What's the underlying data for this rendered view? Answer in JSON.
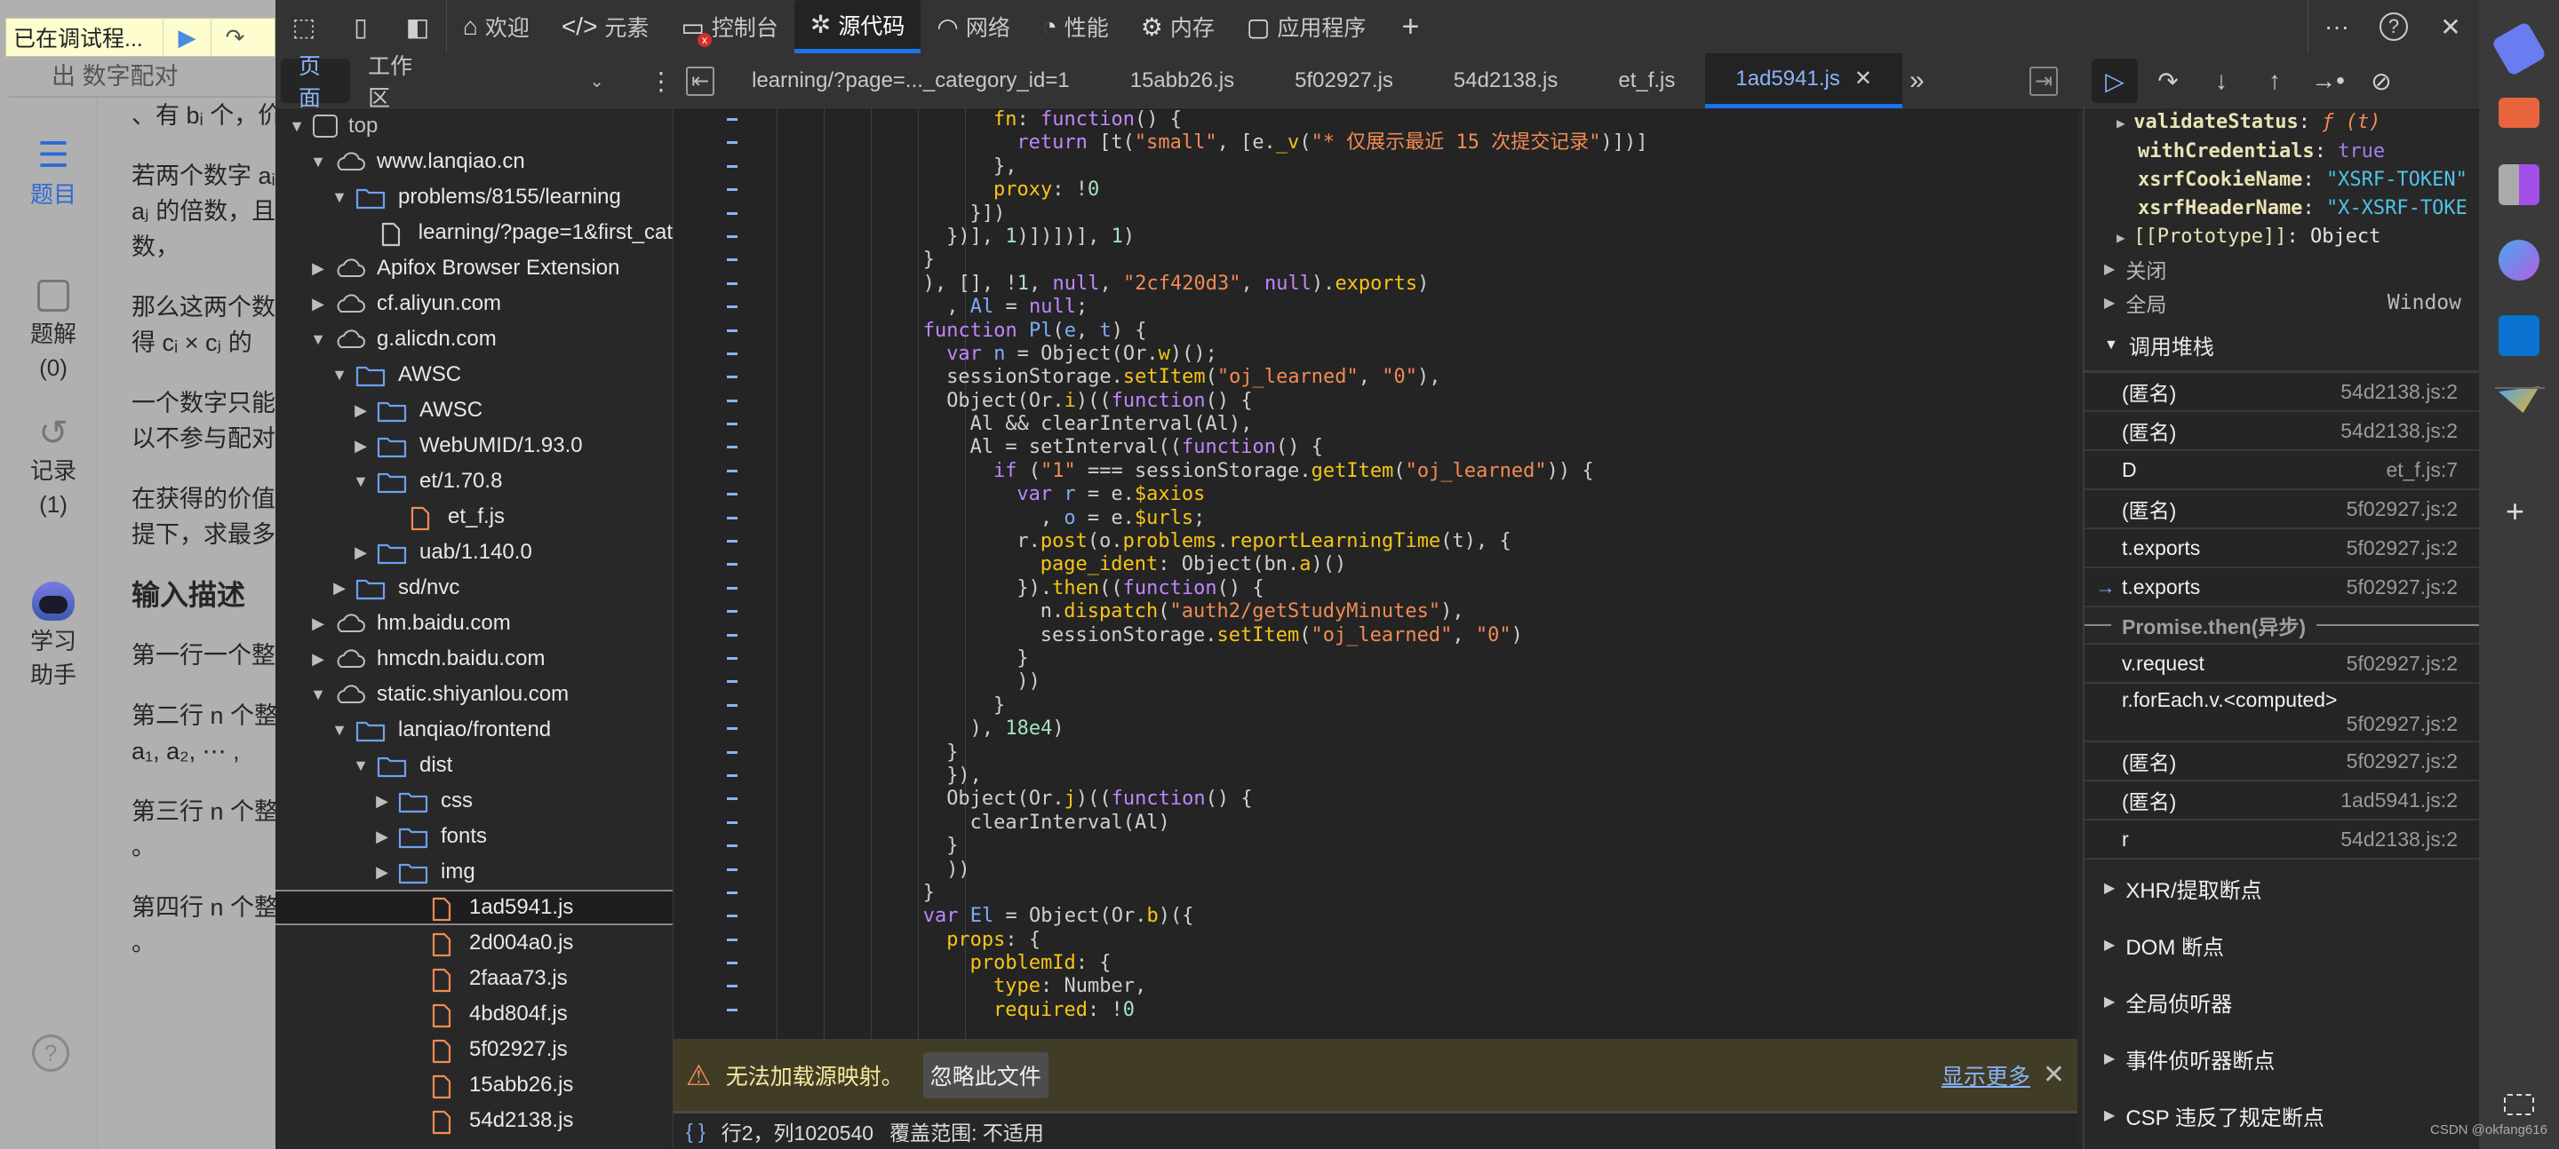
{
  "page": {
    "debug_banner": {
      "text": "已在调试程...",
      "resume_icon": "resume-icon",
      "step_over_icon": "step-over-icon"
    },
    "header_text": "出 数字配对",
    "leftbar": [
      {
        "label": "题目",
        "icon": "problem-list-icon",
        "active": true
      },
      {
        "label": "题解",
        "count": "(0)",
        "icon": "solution-book-icon"
      },
      {
        "label": "记录",
        "count": "(1)",
        "icon": "history-icon"
      },
      {
        "label": "学习",
        "label2": "助手",
        "icon": "assistant-robot-icon"
      }
    ],
    "content": {
      "line0": "、有 bᵢ 个，价",
      "para1": [
        "若两个数字 aᵢ",
        "aⱼ 的倍数，且",
        "数，"
      ],
      "para2": [
        "那么这两个数",
        "得 cᵢ × cⱼ 的"
      ],
      "para3": [
        "一个数字只能",
        "以不参与配对"
      ],
      "para4": [
        "在获得的价值",
        "提下，求最多"
      ],
      "heading": "输入描述",
      "para5": [
        "第一行一个整"
      ],
      "para6": [
        "第二行 n 个整",
        "a₁, a₂, ⋯ ,"
      ],
      "para7": [
        "第三行 n 个整",
        "。"
      ],
      "para8": [
        "第四行 n 个整",
        "。"
      ]
    }
  },
  "toolbar": {
    "tabs": [
      {
        "label": "欢迎",
        "icon": "home-icon"
      },
      {
        "label": "元素",
        "icon": "code-tag-icon"
      },
      {
        "label": "控制台",
        "icon": "console-icon",
        "error_badge": "x"
      },
      {
        "label": "源代码",
        "icon": "bug-icon",
        "active": true
      },
      {
        "label": "网络",
        "icon": "wifi-icon"
      },
      {
        "label": "性能",
        "icon": "gauge-icon"
      },
      {
        "label": "内存",
        "icon": "chip-icon"
      },
      {
        "label": "应用程序",
        "icon": "app-window-icon"
      }
    ],
    "add_tab": "+",
    "more": "···",
    "help": "?",
    "close": "✕"
  },
  "navigator": {
    "tabs": [
      {
        "label": "页面",
        "active": true
      },
      {
        "label": "工作区"
      }
    ],
    "tree": [
      {
        "label": "top",
        "type": "frame",
        "depth": 0,
        "expanded": true
      },
      {
        "label": "www.lanqiao.cn",
        "type": "cloud",
        "depth": 1,
        "expanded": true
      },
      {
        "label": "problems/8155/learning",
        "type": "folder",
        "depth": 2,
        "expanded": true
      },
      {
        "label": "learning/?page=1&first_cat",
        "type": "doc",
        "depth": 3
      },
      {
        "label": "Apifox Browser Extension",
        "type": "cloud",
        "depth": 1,
        "expanded": false
      },
      {
        "label": "cf.aliyun.com",
        "type": "cloud",
        "depth": 1,
        "expanded": false
      },
      {
        "label": "g.alicdn.com",
        "type": "cloud",
        "depth": 1,
        "expanded": true
      },
      {
        "label": "AWSC",
        "type": "folder",
        "depth": 2,
        "expanded": true
      },
      {
        "label": "AWSC",
        "type": "folder",
        "depth": 3,
        "expanded": false
      },
      {
        "label": "WebUMID/1.93.0",
        "type": "folder",
        "depth": 3,
        "expanded": false
      },
      {
        "label": "et/1.70.8",
        "type": "folder",
        "depth": 3,
        "expanded": true
      },
      {
        "label": "et_f.js",
        "type": "js",
        "depth": 4
      },
      {
        "label": "uab/1.140.0",
        "type": "folder",
        "depth": 3,
        "expanded": false
      },
      {
        "label": "sd/nvc",
        "type": "folder",
        "depth": 2,
        "expanded": false
      },
      {
        "label": "hm.baidu.com",
        "type": "cloud",
        "depth": 1,
        "expanded": false
      },
      {
        "label": "hmcdn.baidu.com",
        "type": "cloud",
        "depth": 1,
        "expanded": false
      },
      {
        "label": "static.shiyanlou.com",
        "type": "cloud",
        "depth": 1,
        "expanded": true
      },
      {
        "label": "lanqiao/frontend",
        "type": "folder",
        "depth": 2,
        "expanded": true
      },
      {
        "label": "dist",
        "type": "folder",
        "depth": 3,
        "expanded": true
      },
      {
        "label": "css",
        "type": "folder",
        "depth": 4,
        "expanded": false
      },
      {
        "label": "fonts",
        "type": "folder",
        "depth": 4,
        "expanded": false
      },
      {
        "label": "img",
        "type": "folder",
        "depth": 4,
        "expanded": false
      },
      {
        "label": "1ad5941.js",
        "type": "js",
        "depth": 5,
        "selected": true
      },
      {
        "label": "2d004a0.js",
        "type": "js",
        "depth": 5
      },
      {
        "label": "2faaa73.js",
        "type": "js",
        "depth": 5
      },
      {
        "label": "4bd804f.js",
        "type": "js",
        "depth": 5
      },
      {
        "label": "5f02927.js",
        "type": "js",
        "depth": 5
      },
      {
        "label": "15abb26.js",
        "type": "js",
        "depth": 5
      },
      {
        "label": "54d2138.js",
        "type": "js",
        "depth": 5
      }
    ]
  },
  "editor": {
    "tabs": [
      {
        "label": "learning/?page=..._category_id=1"
      },
      {
        "label": "15abb26.js"
      },
      {
        "label": "5f02927.js"
      },
      {
        "label": "54d2138.js"
      },
      {
        "label": "et_f.js"
      },
      {
        "label": "1ad5941.js",
        "active": true,
        "closable": true
      }
    ],
    "overflow": "»",
    "lines": [
      {
        "indent": 10,
        "tokens": [
          [
            "p",
            "fn"
          ],
          [
            "t",
            ": "
          ],
          [
            "k",
            "function"
          ],
          [
            "t",
            "() {"
          ]
        ]
      },
      {
        "indent": 12,
        "tokens": [
          [
            "k",
            "return"
          ],
          [
            "t",
            " [t("
          ],
          [
            "s",
            "\"small\""
          ],
          [
            "t",
            ", [e."
          ],
          [
            "p",
            "_v"
          ],
          [
            "t",
            "("
          ],
          [
            "s",
            "\"* 仅展示最近 15 次提交记录\""
          ],
          [
            "t",
            ")])]"
          ]
        ]
      },
      {
        "indent": 10,
        "tokens": [
          [
            "t",
            "},"
          ]
        ]
      },
      {
        "indent": 10,
        "tokens": [
          [
            "p",
            "proxy"
          ],
          [
            "t",
            ": !"
          ],
          [
            "n",
            "0"
          ]
        ]
      },
      {
        "indent": 8,
        "tokens": [
          [
            "t",
            "}])"
          ]
        ]
      },
      {
        "indent": 6,
        "tokens": [
          [
            "t",
            "})], "
          ],
          [
            "n",
            "1"
          ],
          [
            "t",
            ")])])], "
          ],
          [
            "n",
            "1"
          ],
          [
            "t",
            ")"
          ]
        ]
      },
      {
        "indent": 4,
        "tokens": [
          [
            "t",
            "}"
          ]
        ]
      },
      {
        "indent": 4,
        "tokens": [
          [
            "t",
            "), [], !"
          ],
          [
            "n",
            "1"
          ],
          [
            "t",
            ", "
          ],
          [
            "k",
            "null"
          ],
          [
            "t",
            ", "
          ],
          [
            "s",
            "\"2cf420d3\""
          ],
          [
            "t",
            ", "
          ],
          [
            "k",
            "null"
          ],
          [
            "t",
            ")."
          ],
          [
            "p",
            "exports"
          ],
          [
            "t",
            ")"
          ]
        ]
      },
      {
        "indent": 4,
        "tokens": [
          [
            "t",
            "  , "
          ],
          [
            "v",
            "Al"
          ],
          [
            "t",
            " = "
          ],
          [
            "k",
            "null"
          ],
          [
            "t",
            ";"
          ]
        ]
      },
      {
        "indent": 4,
        "tokens": [
          [
            "k",
            "function"
          ],
          [
            "t",
            " "
          ],
          [
            "v",
            "Pl"
          ],
          [
            "t",
            "("
          ],
          [
            "v",
            "e"
          ],
          [
            "t",
            ", "
          ],
          [
            "v",
            "t"
          ],
          [
            "t",
            ") {"
          ]
        ]
      },
      {
        "indent": 6,
        "tokens": [
          [
            "k",
            "var"
          ],
          [
            "t",
            " "
          ],
          [
            "v",
            "n"
          ],
          [
            "t",
            " = Object(Or."
          ],
          [
            "p",
            "w"
          ],
          [
            "t",
            ")();"
          ]
        ]
      },
      {
        "indent": 6,
        "tokens": [
          [
            "t",
            "sessionStorage."
          ],
          [
            "p",
            "setItem"
          ],
          [
            "t",
            "("
          ],
          [
            "s",
            "\"oj_learned\""
          ],
          [
            "t",
            ", "
          ],
          [
            "s",
            "\"0\""
          ],
          [
            "t",
            "),"
          ]
        ]
      },
      {
        "indent": 6,
        "tokens": [
          [
            "t",
            "Object(Or."
          ],
          [
            "p",
            "i"
          ],
          [
            "t",
            ")(("
          ],
          [
            "k",
            "function"
          ],
          [
            "t",
            "() {"
          ]
        ]
      },
      {
        "indent": 8,
        "tokens": [
          [
            "t",
            "Al && clearInterval(Al),"
          ]
        ]
      },
      {
        "indent": 8,
        "tokens": [
          [
            "t",
            "Al = setInterval(("
          ],
          [
            "k",
            "function"
          ],
          [
            "t",
            "() {"
          ]
        ]
      },
      {
        "indent": 10,
        "tokens": [
          [
            "k",
            "if"
          ],
          [
            "t",
            " ("
          ],
          [
            "s",
            "\"1\""
          ],
          [
            "t",
            " === sessionStorage."
          ],
          [
            "p",
            "getItem"
          ],
          [
            "t",
            "("
          ],
          [
            "s",
            "\"oj_learned\""
          ],
          [
            "t",
            ")) {"
          ]
        ]
      },
      {
        "indent": 12,
        "tokens": [
          [
            "k",
            "var"
          ],
          [
            "t",
            " "
          ],
          [
            "v",
            "r"
          ],
          [
            "t",
            " = e."
          ],
          [
            "p",
            "$axios"
          ]
        ]
      },
      {
        "indent": 12,
        "tokens": [
          [
            "t",
            "  , "
          ],
          [
            "v",
            "o"
          ],
          [
            "t",
            " = e."
          ],
          [
            "p",
            "$urls"
          ],
          [
            "t",
            ";"
          ]
        ]
      },
      {
        "indent": 12,
        "tokens": [
          [
            "t",
            "r."
          ],
          [
            "p",
            "post"
          ],
          [
            "t",
            "(o."
          ],
          [
            "p",
            "problems"
          ],
          [
            "t",
            "."
          ],
          [
            "p",
            "reportLearningTime"
          ],
          [
            "t",
            "(t), {"
          ]
        ]
      },
      {
        "indent": 14,
        "tokens": [
          [
            "p",
            "page_ident"
          ],
          [
            "t",
            ": Object(bn."
          ],
          [
            "p",
            "a"
          ],
          [
            "t",
            ")()"
          ]
        ]
      },
      {
        "indent": 12,
        "tokens": [
          [
            "t",
            "})."
          ],
          [
            "p",
            "then"
          ],
          [
            "t",
            "(("
          ],
          [
            "k",
            "function"
          ],
          [
            "t",
            "() {"
          ]
        ]
      },
      {
        "indent": 14,
        "tokens": [
          [
            "t",
            "n."
          ],
          [
            "p",
            "dispatch"
          ],
          [
            "t",
            "("
          ],
          [
            "s",
            "\"auth2/getStudyMinutes\""
          ],
          [
            "t",
            "),"
          ]
        ]
      },
      {
        "indent": 14,
        "tokens": [
          [
            "t",
            "sessionStorage."
          ],
          [
            "p",
            "setItem"
          ],
          [
            "t",
            "("
          ],
          [
            "s",
            "\"oj_learned\""
          ],
          [
            "t",
            ", "
          ],
          [
            "s",
            "\"0\""
          ],
          [
            "t",
            ")"
          ]
        ]
      },
      {
        "indent": 12,
        "tokens": [
          [
            "t",
            "}"
          ]
        ]
      },
      {
        "indent": 12,
        "tokens": [
          [
            "t",
            "))"
          ]
        ]
      },
      {
        "indent": 10,
        "tokens": [
          [
            "t",
            "}"
          ]
        ]
      },
      {
        "indent": 8,
        "tokens": [
          [
            "t",
            "), "
          ],
          [
            "n",
            "18e4"
          ],
          [
            "t",
            ")"
          ]
        ]
      },
      {
        "indent": 6,
        "tokens": [
          [
            "t",
            "}"
          ]
        ]
      },
      {
        "indent": 6,
        "tokens": [
          [
            "t",
            "}),"
          ]
        ]
      },
      {
        "indent": 6,
        "tokens": [
          [
            "t",
            "Object(Or."
          ],
          [
            "p",
            "j"
          ],
          [
            "t",
            ")(("
          ],
          [
            "k",
            "function"
          ],
          [
            "t",
            "() {"
          ]
        ]
      },
      {
        "indent": 8,
        "tokens": [
          [
            "t",
            "clearInterval(Al)"
          ]
        ]
      },
      {
        "indent": 6,
        "tokens": [
          [
            "t",
            "}"
          ]
        ]
      },
      {
        "indent": 6,
        "tokens": [
          [
            "t",
            "))"
          ]
        ]
      },
      {
        "indent": 4,
        "tokens": [
          [
            "t",
            "}"
          ]
        ]
      },
      {
        "indent": 4,
        "tokens": [
          [
            "k",
            "var"
          ],
          [
            "t",
            " "
          ],
          [
            "v",
            "El"
          ],
          [
            "t",
            " = Object(Or."
          ],
          [
            "p",
            "b"
          ],
          [
            "t",
            ")({"
          ]
        ]
      },
      {
        "indent": 6,
        "tokens": [
          [
            "p",
            "props"
          ],
          [
            "t",
            ": {"
          ]
        ]
      },
      {
        "indent": 8,
        "tokens": [
          [
            "p",
            "problemId"
          ],
          [
            "t",
            ": {"
          ]
        ]
      },
      {
        "indent": 10,
        "tokens": [
          [
            "p",
            "type"
          ],
          [
            "t",
            ": Number,"
          ]
        ]
      },
      {
        "indent": 10,
        "tokens": [
          [
            "p",
            "required"
          ],
          [
            "t",
            ": !"
          ],
          [
            "n",
            "0"
          ]
        ]
      }
    ],
    "warning": {
      "text": "无法加载源映射。",
      "ignore_button": "忽略此文件",
      "show_more": "显示更多",
      "close": "✕"
    },
    "status": {
      "braces": "{ }",
      "position": "行2，列1020540",
      "coverage": "覆盖范围: 不适用"
    }
  },
  "debugger": {
    "scope_lines": [
      {
        "key": "validateStatus",
        "value": "ƒ (t)",
        "vtype": "func",
        "expandable": true
      },
      {
        "key": "withCredentials",
        "value": "true",
        "vtype": "bool"
      },
      {
        "key": "xsrfCookieName",
        "value": "\"XSRF-TOKEN\"",
        "vtype": "str"
      },
      {
        "key": "xsrfHeaderName",
        "value": "\"X-XSRF-TOKE",
        "vtype": "str"
      },
      {
        "key": "[[Prototype]]",
        "value": "Object",
        "vtype": "plain",
        "expandable": true
      }
    ],
    "scopes": [
      {
        "label": "关闭",
        "value": ""
      },
      {
        "label": "全局",
        "value": "Window"
      }
    ],
    "callstack_title": "调用堆栈",
    "callstack": [
      {
        "name": "(匿名)",
        "loc": "54d2138.js:2"
      },
      {
        "name": "(匿名)",
        "loc": "54d2138.js:2"
      },
      {
        "name": "D",
        "loc": "et_f.js:7"
      },
      {
        "name": "(匿名)",
        "loc": "5f02927.js:2"
      },
      {
        "name": "t.exports",
        "loc": "5f02927.js:2"
      },
      {
        "name": "t.exports",
        "loc": "5f02927.js:2",
        "current": true
      }
    ],
    "async_label": "Promise.then(异步)",
    "callstack_async": [
      {
        "name": "v.request",
        "loc": "5f02927.js:2"
      },
      {
        "name": "r.forEach.v.<computed>",
        "loc": "5f02927.js:2",
        "wrap": true
      },
      {
        "name": "(匿名)",
        "loc": "5f02927.js:2"
      },
      {
        "name": "(匿名)",
        "loc": "1ad5941.js:2"
      },
      {
        "name": "r",
        "loc": "54d2138.js:2"
      }
    ],
    "breakpoint_sections": [
      "XHR/提取断点",
      "DOM 断点",
      "全局侦听器",
      "事件侦听器断点",
      "CSP 违反了规定断点"
    ]
  },
  "browser_sidebar": {
    "icons": [
      "tag-icon",
      "toolbox-icon",
      "chess-icon",
      "copilot-icon",
      "outlook-icon",
      "send-icon"
    ],
    "add": "+"
  },
  "watermark": "CSDN @okfang616",
  "colors": {
    "accent": "#1a73e8",
    "link": "#8ab4f8",
    "warning_bg": "#413c26",
    "js_file": "#f28b54",
    "folder": "#6ea0f0"
  }
}
